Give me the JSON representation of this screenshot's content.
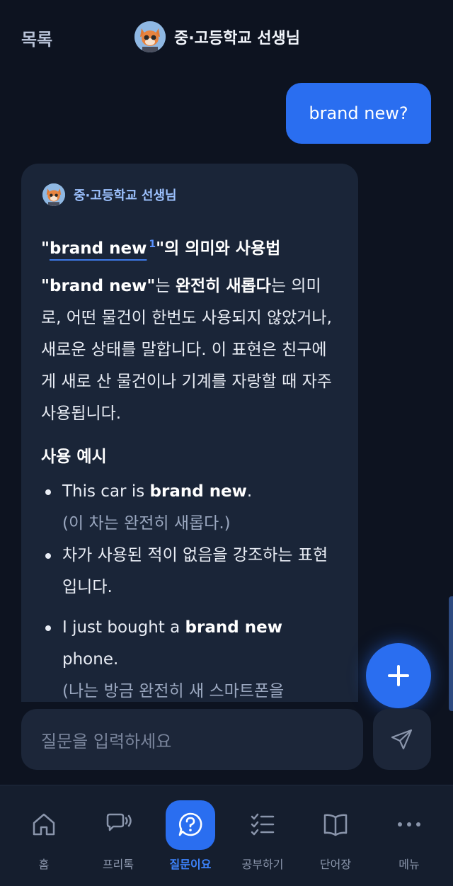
{
  "header": {
    "back": "목록",
    "title": "중·고등학교 선생님"
  },
  "user_message": "brand new?",
  "bot": {
    "name": "중·고등학교 선생님",
    "title_quote_open": "\"",
    "title_term": "brand new",
    "title_sup": "1",
    "title_rest": "\"의 의미와 사용법",
    "p1_bold1": "\"brand new\"",
    "p1_t1": "는 ",
    "p1_bold2": "완전히 새롭다",
    "p1_t2": "는 의미로, 어떤 물건이 한번도 사용되지 않았거나, 새로운 상태를 말합니다. 이 표현은 친구에게 새로 산 물건이나 기계를 자랑할 때 자주 사용됩니다.",
    "section": "사용 예시",
    "ex1_pre": "This car is ",
    "ex1_bold": "brand new",
    "ex1_post": ".",
    "ex1_trans": "(이 차는 완전히 새롭다.)",
    "ex1_note": "차가 사용된 적이 없음을 강조하는 표현입니다.",
    "ex2_pre": "I just bought a ",
    "ex2_bold": "brand new",
    "ex2_post": " phone.",
    "ex2_trans": "(나는 방금 완전히 새 스마트폰을"
  },
  "input": {
    "placeholder": "질문을 입력하세요"
  },
  "tabs": [
    {
      "label": "홈",
      "icon": "home-icon"
    },
    {
      "label": "프리톡",
      "icon": "chat-voice-icon"
    },
    {
      "label": "질문이요",
      "icon": "question-bubble-icon"
    },
    {
      "label": "공부하기",
      "icon": "checklist-icon"
    },
    {
      "label": "단어장",
      "icon": "book-icon"
    },
    {
      "label": "메뉴",
      "icon": "more-icon"
    }
  ],
  "active_tab": "질문이요",
  "colors": {
    "accent": "#2a6ef0",
    "background": "#0d1320",
    "card": "#1a2538"
  }
}
